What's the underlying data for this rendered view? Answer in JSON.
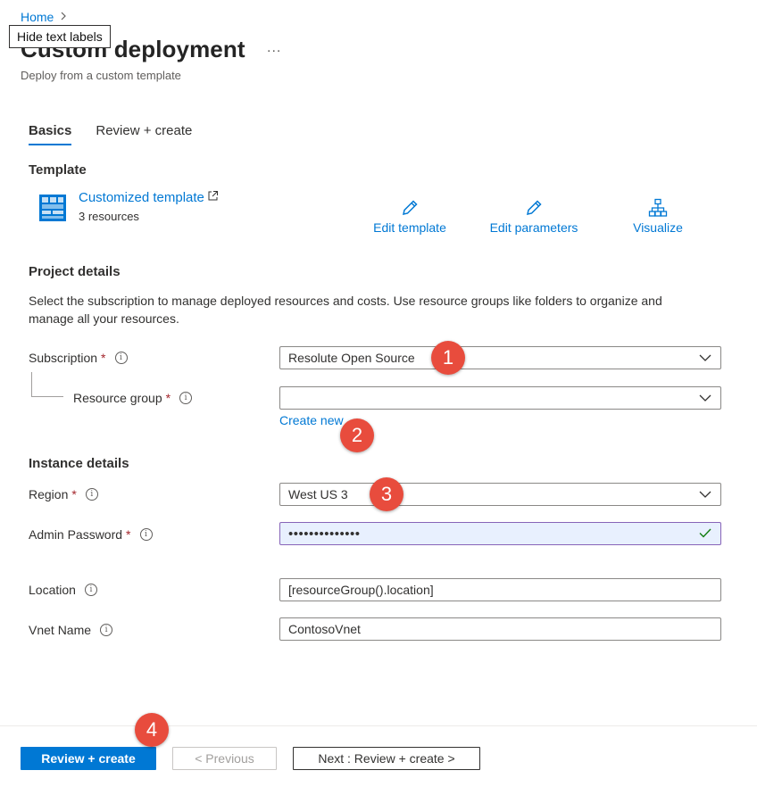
{
  "breadcrumb": {
    "home": "Home"
  },
  "tooltip": {
    "text": "Hide text labels"
  },
  "header": {
    "title": "Custom deployment",
    "more": "...",
    "subtitle": "Deploy from a custom template"
  },
  "tabs": [
    {
      "label": "Basics",
      "active": true
    },
    {
      "label": "Review + create",
      "active": false
    }
  ],
  "template": {
    "section_title": "Template",
    "name": "Customized template",
    "resources": "3 resources",
    "actions": {
      "edit_template": "Edit template",
      "edit_parameters": "Edit parameters",
      "visualize": "Visualize"
    }
  },
  "project": {
    "section_title": "Project details",
    "description": "Select the subscription to manage deployed resources and costs. Use resource groups like folders to organize and manage all your resources.",
    "subscription": {
      "label": "Subscription",
      "required": "*",
      "value": "Resolute Open Source"
    },
    "resource_group": {
      "label": "Resource group",
      "required": "*",
      "value": "",
      "create_new": "Create new"
    }
  },
  "instance": {
    "section_title": "Instance details",
    "region": {
      "label": "Region",
      "required": "*",
      "value": "West US 3"
    },
    "admin_password": {
      "label": "Admin Password",
      "required": "*",
      "value": "••••••••••••••"
    },
    "location": {
      "label": "Location",
      "value": "[resourceGroup().location]"
    },
    "vnet_name": {
      "label": "Vnet Name",
      "value": "ContosoVnet"
    }
  },
  "callouts": [
    "1",
    "2",
    "3",
    "4"
  ],
  "footer": {
    "review_create": "Review + create",
    "previous": "< Previous",
    "next": "Next : Review + create >"
  },
  "colors": {
    "accent": "#0078d4",
    "callout": "#e84c3d",
    "required": "#a4262c",
    "valid_check": "#107c10"
  }
}
